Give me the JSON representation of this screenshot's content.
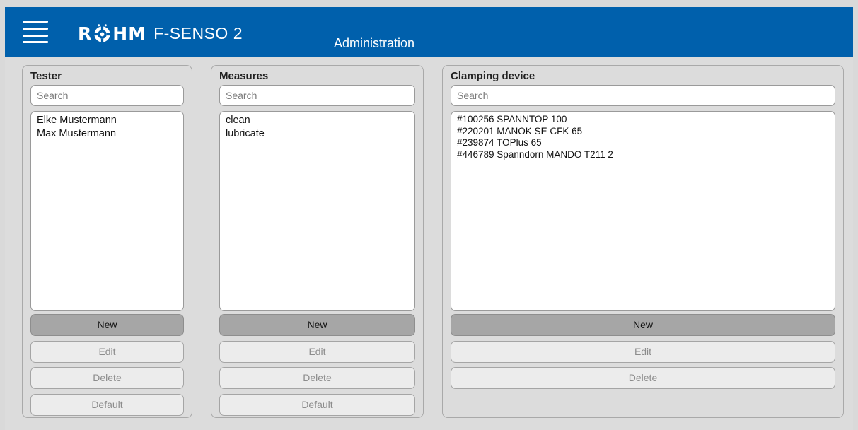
{
  "header": {
    "brand_logo": "RÖHM",
    "product": "F-SENSO 2",
    "section": "Administration",
    "menu_icon": "hamburger-menu-icon",
    "color": "#0060ac"
  },
  "panels": {
    "tester": {
      "title": "Tester",
      "search_placeholder": "Search",
      "items": [
        "Elke Mustermann",
        "Max Mustermann"
      ],
      "new_label": "New",
      "edit_label": "Edit",
      "delete_label": "Delete",
      "default_label": "Default"
    },
    "measures": {
      "title": "Measures",
      "search_placeholder": "Search",
      "items": [
        "clean",
        "lubricate"
      ],
      "new_label": "New",
      "edit_label": "Edit",
      "delete_label": "Delete",
      "default_label": "Default"
    },
    "clamping": {
      "title": "Clamping device",
      "search_placeholder": "Search",
      "items": [
        "#100256 SPANNTOP 100",
        "#220201 MANOK SE CFK 65",
        "#239874 TOPlus 65",
        "#446789 Spanndorn MANDO T211 2"
      ],
      "new_label": "New",
      "edit_label": "Edit",
      "delete_label": "Delete"
    }
  }
}
